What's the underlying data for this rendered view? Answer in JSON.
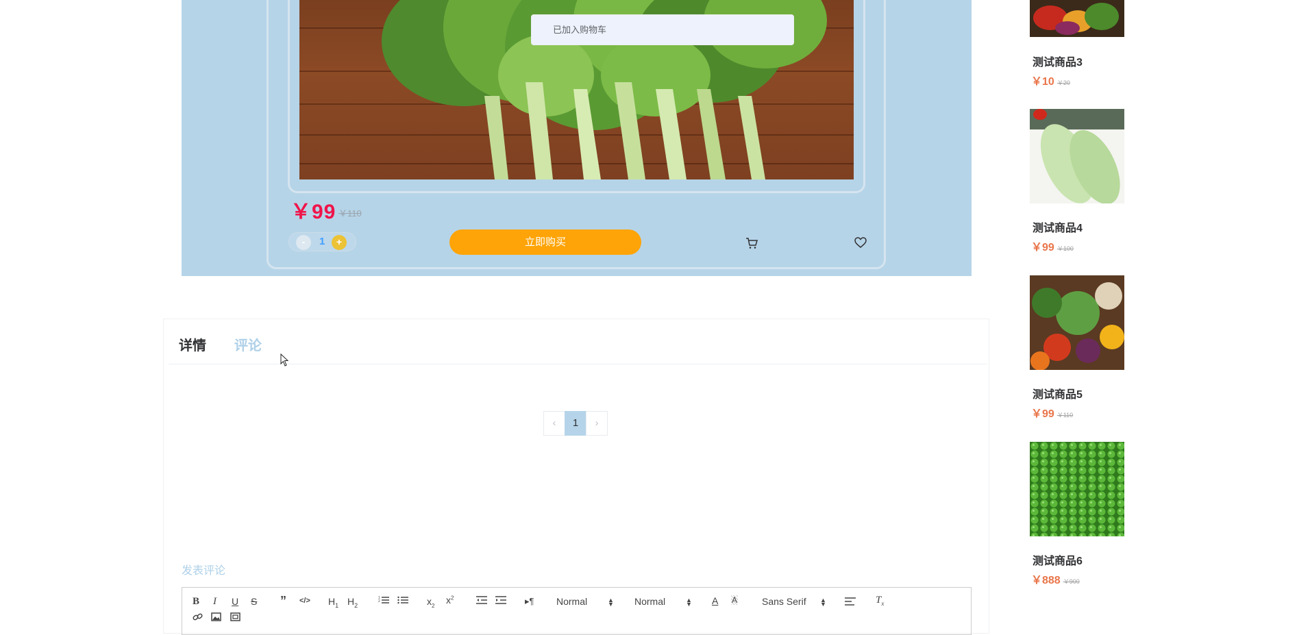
{
  "toast": {
    "message": "已加入购物车"
  },
  "product": {
    "price": "￥99",
    "old_price": "￥110",
    "quantity": "1",
    "minus": "-",
    "plus": "+",
    "buy_label": "立即购买"
  },
  "tabs": {
    "detail": "详情",
    "comment": "评论"
  },
  "pagination": {
    "prev": "‹",
    "current": "1",
    "next": "›"
  },
  "comment_section": {
    "label": "发表评论"
  },
  "editor_toolbar": {
    "size_select": "Normal",
    "header_select": "Normal",
    "font_select": "Sans Serif",
    "icons": [
      "bold-icon",
      "italic-icon",
      "underline-icon",
      "strike-icon",
      "blockquote-icon",
      "code-block-icon",
      "h1-icon",
      "h2-icon",
      "ordered-list-icon",
      "bullet-list-icon",
      "subscript-icon",
      "superscript-icon",
      "outdent-icon",
      "indent-icon",
      "rtl-icon",
      "text-color-icon",
      "background-color-icon",
      "align-icon",
      "clean-format-icon",
      "link-icon",
      "image-icon",
      "video-icon"
    ]
  },
  "sidebar": {
    "items": [
      {
        "name": "测试商品3",
        "price": "￥10",
        "old_price": "￥20"
      },
      {
        "name": "测试商品4",
        "price": "￥99",
        "old_price": "￥100"
      },
      {
        "name": "测试商品5",
        "price": "￥99",
        "old_price": "￥110"
      },
      {
        "name": "测试商品6",
        "price": "￥888",
        "old_price": "￥900"
      }
    ]
  },
  "colors": {
    "hero_bg": "#b6d4e8",
    "price_red": "#f0144a",
    "buy_orange": "#fea408",
    "side_price": "#e9754a",
    "tab_inactive": "#aed0e8"
  }
}
